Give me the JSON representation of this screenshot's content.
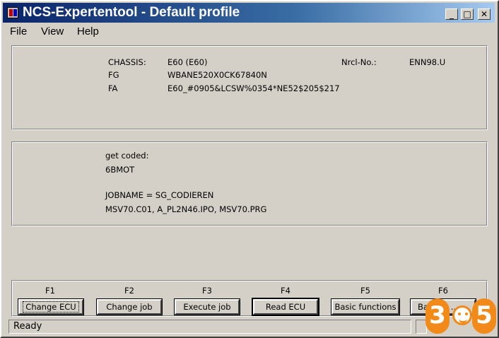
{
  "window": {
    "title": "NCS-Expertentool - Default profile"
  },
  "titlebar_buttons": {
    "minimize": "_",
    "maximize": "□",
    "close": "✕"
  },
  "menu": [
    "File",
    "View",
    "Help"
  ],
  "vehicle": {
    "chassis_label": "CHASSIS:",
    "chassis_value": "E60 (E60)",
    "nrcl_label": "Nrcl-No.:",
    "nrcl_value": "ENN98.U",
    "fg_label": "FG",
    "fg_value": "WBANE520X0CK67840N",
    "fa_label": "FA",
    "fa_value": "E60_#0905&LCSW%0354*NE52$205$217"
  },
  "job": {
    "line1": "get coded:",
    "line2": "6BMOT",
    "line3": "JOBNAME = SG_CODIEREN",
    "line4": "MSV70.C01, A_PL2N46.IPO, MSV70.PRG"
  },
  "fkeys": [
    {
      "key": "F1",
      "label": "Change ECU"
    },
    {
      "key": "F2",
      "label": "Change job"
    },
    {
      "key": "F3",
      "label": "Execute job"
    },
    {
      "key": "F4",
      "label": "Read ECU"
    },
    {
      "key": "F5",
      "label": "Basic functions"
    },
    {
      "key": "F6",
      "label": "Back to ..."
    }
  ],
  "status": {
    "text": "Ready"
  },
  "watermark": {
    "digits": [
      "3",
      "5"
    ],
    "color": "#f28a1a"
  }
}
